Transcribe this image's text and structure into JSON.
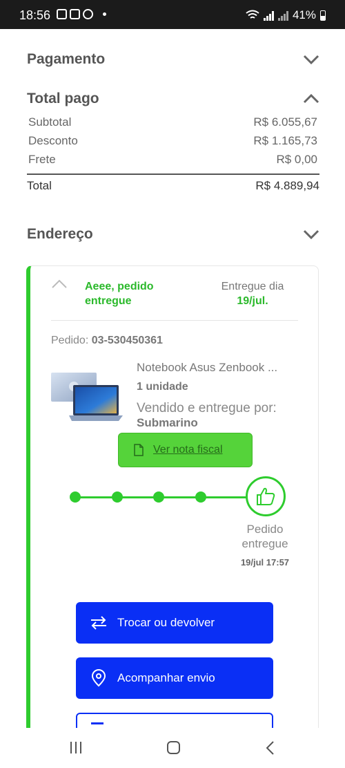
{
  "status_bar": {
    "time": "18:56",
    "battery": "41%"
  },
  "payment": {
    "title": "Pagamento"
  },
  "total_paid": {
    "title": "Total pago",
    "rows": [
      {
        "label": "Subtotal",
        "value": "R$ 6.055,67"
      },
      {
        "label": "Desconto",
        "value": "R$ 1.165,73"
      },
      {
        "label": "Frete",
        "value": "R$ 0,00"
      }
    ],
    "total_label": "Total",
    "total_value": "R$ 4.889,94"
  },
  "address": {
    "title": "Endereço"
  },
  "order": {
    "status_line1": "Aeee, pedido",
    "status_line2": "entregue",
    "delivered_label": "Entregue dia",
    "delivered_date": "19/jul.",
    "order_label": "Pedido:",
    "order_number": "03-530450361",
    "product_name": "Notebook Asus Zenbook ...",
    "quantity": "1 unidade",
    "seller_label": "Vendido e entregue por:",
    "seller": "Submarino",
    "invoice_button": "Ver nota fiscal",
    "track_label_line1": "Pedido",
    "track_label_line2": "entregue",
    "track_date": "19/jul 17:57",
    "actions": [
      {
        "label": "Trocar ou devolver",
        "icon": "swap-icon"
      },
      {
        "label": "Acompanhar envio",
        "icon": "location-pin-icon"
      }
    ]
  },
  "colors": {
    "accent_green": "#2ecc2e",
    "button_blue": "#0a2ff5",
    "invoice_green": "#55d33a"
  }
}
